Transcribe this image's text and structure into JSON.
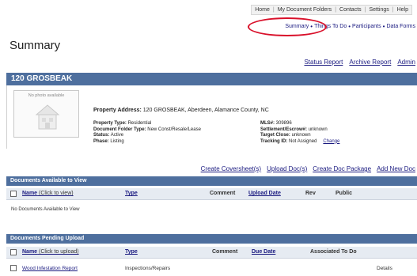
{
  "topnav": {
    "items": [
      "Home",
      "My Document Folders",
      "Contacts",
      "Settings",
      "Help"
    ]
  },
  "subnav": {
    "items": [
      "Summary",
      "Things To Do",
      "Participants",
      "Data Forms"
    ]
  },
  "page": {
    "title": "Summary"
  },
  "reports": [
    "Status Report",
    "Archive Report",
    "Admin"
  ],
  "property": {
    "header": "120 GROSBEAK",
    "photo_placeholder": "No photo available",
    "address_label": "Property Address:",
    "address_value": "120 GROSBEAK, Aberdeen, Alamance County, NC",
    "left_fields": [
      {
        "label": "Property Type:",
        "value": "Residential"
      },
      {
        "label": "Document Folder Type:",
        "value": "New Const/Resale/Lease"
      },
      {
        "label": "Status:",
        "value": "Active"
      },
      {
        "label": "Phase:",
        "value": "Listing"
      }
    ],
    "right_fields": [
      {
        "label": "MLS#:",
        "value": "309896"
      },
      {
        "label": "Settlement/Escrow#:",
        "value": "unknown"
      },
      {
        "label": "Target Close:",
        "value": "unknown"
      },
      {
        "label": "Tracking ID:",
        "value": "Not Assigned"
      }
    ],
    "change_label": "Change"
  },
  "doc_actions": [
    "Create Coversheet(s)",
    "Upload Doc(s)",
    "Create Doc Package",
    "Add New Doc"
  ],
  "available": {
    "title": "Documents Available to View",
    "columns": {
      "name": "Name",
      "name_hint": "(Click to view)",
      "type": "Type",
      "comment": "Comment",
      "upload_date": "Upload Date",
      "rev": "Rev",
      "public": "Public"
    },
    "empty_text": "No Documents Available to View"
  },
  "pending": {
    "title": "Documents Pending Upload",
    "columns": {
      "name": "Name",
      "name_hint": "(Click to upload)",
      "type": "Type",
      "comment": "Comment",
      "due_date": "Due Date",
      "associated": "Associated To Do"
    },
    "rows": [
      {
        "name": "Wood Infestation Report",
        "type": "Inspections/Repairs",
        "action": "Details"
      }
    ]
  },
  "colors": {
    "bar": "#4e6f9e",
    "link": "#1a1a80",
    "highlight": "#d9102a"
  }
}
